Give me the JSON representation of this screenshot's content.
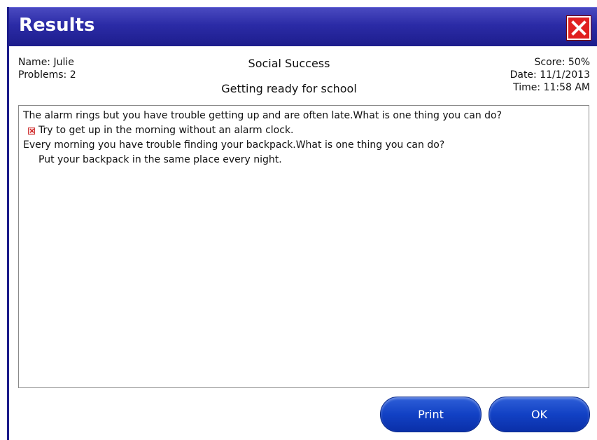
{
  "window": {
    "title": "Results"
  },
  "info": {
    "name": "Name: Julie",
    "problems": "Problems: 2",
    "subject": "Social Success",
    "lesson": "Getting ready for school",
    "score": "Score: 50%",
    "date": "Date: 11/1/2013",
    "time": "Time: 11:58 AM"
  },
  "results": [
    {
      "question": "The alarm rings but you have trouble getting up and are often late.What is one thing you can do?",
      "answer": "Try to get up in the morning without an alarm clock.",
      "mark": "incorrect"
    },
    {
      "question": "Every morning you have trouble finding your backpack.What is one thing you can do?",
      "answer": "Put your backpack in the same place every night.",
      "mark": "none"
    }
  ],
  "buttons": {
    "print": "Print",
    "ok": "OK"
  },
  "colors": {
    "titlebar": "#2b2ba6",
    "close": "#e02020",
    "button": "#1241c4"
  },
  "icons": {
    "close": "close-icon",
    "incorrect": "x-mark-icon"
  }
}
